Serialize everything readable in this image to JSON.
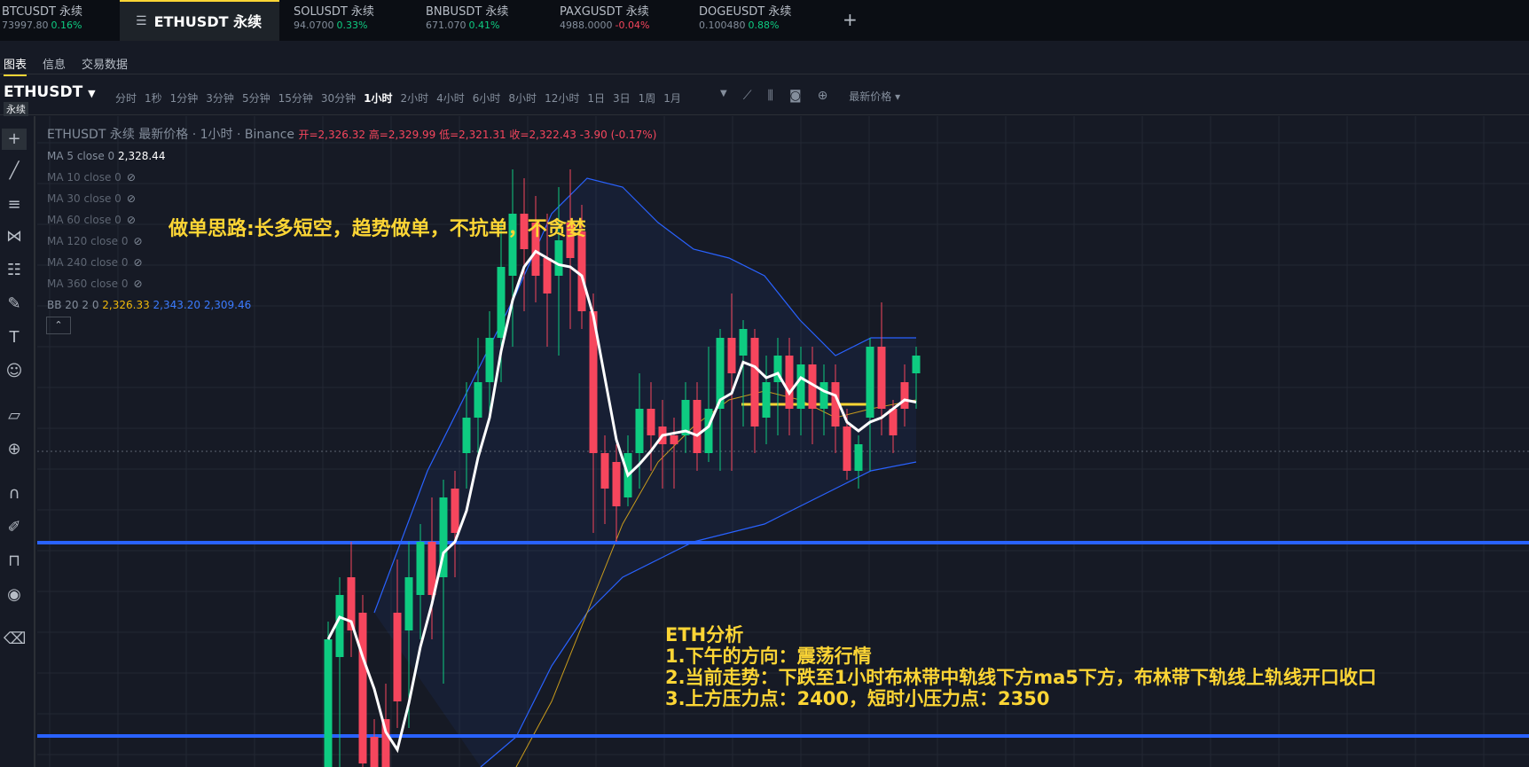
{
  "tabs": [
    {
      "symbol": "BTCUSDT 永续",
      "price": "73997.80",
      "change": "0.16%",
      "dir": "up"
    },
    {
      "symbol": "ETHUSDT 永续",
      "active": true
    },
    {
      "symbol": "SOLUSDT 永续",
      "price": "94.0700",
      "change": "0.33%",
      "dir": "up"
    },
    {
      "symbol": "BNBUSDT 永续",
      "price": "671.070",
      "change": "0.41%",
      "dir": "up"
    },
    {
      "symbol": "PAXGUSDT 永续",
      "price": "4988.0000",
      "change": "-0.04%",
      "dir": "down"
    },
    {
      "symbol": "DOGEUSDT 永续",
      "price": "0.100480",
      "change": "0.88%",
      "dir": "up"
    }
  ],
  "add_tab": "+",
  "subnav": {
    "chart": "图表",
    "info": "信息",
    "trading_data": "交易数据"
  },
  "toolbar": {
    "symbol": "ETHUSDT",
    "tag": "永续",
    "intervals": [
      "分时",
      "1秒",
      "1分钟",
      "3分钟",
      "5分钟",
      "15分钟",
      "30分钟",
      "1小时",
      "2小时",
      "4小时",
      "6小时",
      "8小时",
      "12小时",
      "1日",
      "3日",
      "1周",
      "1月"
    ],
    "active_interval": "1小时",
    "price_type": "最新价格"
  },
  "legend": {
    "title": "ETHUSDT 永续 最新价格 · 1小时 · Binance",
    "ohlc": "开=2,326.32 高=2,329.99 低=2,321.31 收=2,322.43 -3.90 (-0.17%)",
    "ma5_label": "MA 5 close 0",
    "ma5_value": "2,328.44",
    "hidden_mas": [
      "MA 10 close 0",
      "MA 30 close 0",
      "MA 60 close 0",
      "MA 120 close 0",
      "MA 240 close 0",
      "MA 360 close 0"
    ],
    "bb_label": "BB 20 2 0",
    "bb_mid": "2,326.33",
    "bb_upper": "2,343.20",
    "bb_lower": "2,309.46"
  },
  "annotations": {
    "strategy": "做单思路:长多短空，趋势做单，不抗单，不贪婪",
    "analysis_title": "ETH分析",
    "analysis_lines": [
      "1.下午的方向：震荡行情",
      "2.当前走势：下跌至1小时布林带中轨线下方ma5下方，布林带下轨线上轨线开口收口",
      "3.上方压力点：2400，短时小压力点：2350"
    ]
  },
  "colors": {
    "up": "#0ecb81",
    "down": "#f6465d",
    "accent": "#fcd535",
    "hline": "#2962ff"
  }
}
